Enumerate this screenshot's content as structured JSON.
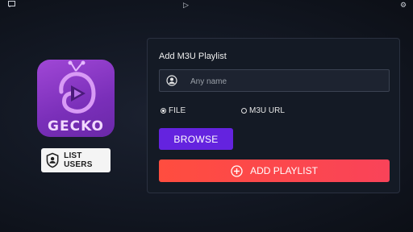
{
  "topbar": {
    "center_icon": "▷",
    "right_icon": "⚙"
  },
  "logo": {
    "text": "GECKO"
  },
  "list_users": {
    "label": "LIST USERS"
  },
  "panel": {
    "title": "Add M3U Playlist",
    "name_field": {
      "placeholder": "Any name",
      "value": ""
    },
    "radio": {
      "file_label": "FILE",
      "url_label": "M3U URL",
      "selected": "file"
    },
    "browse_label": "BROWSE",
    "add_playlist_label": "ADD PLAYLIST"
  },
  "colors": {
    "browse": "#6423df",
    "add_playlist_start": "#ff4d3f",
    "add_playlist_end": "#f94359",
    "logo": "#8e3bc8"
  }
}
